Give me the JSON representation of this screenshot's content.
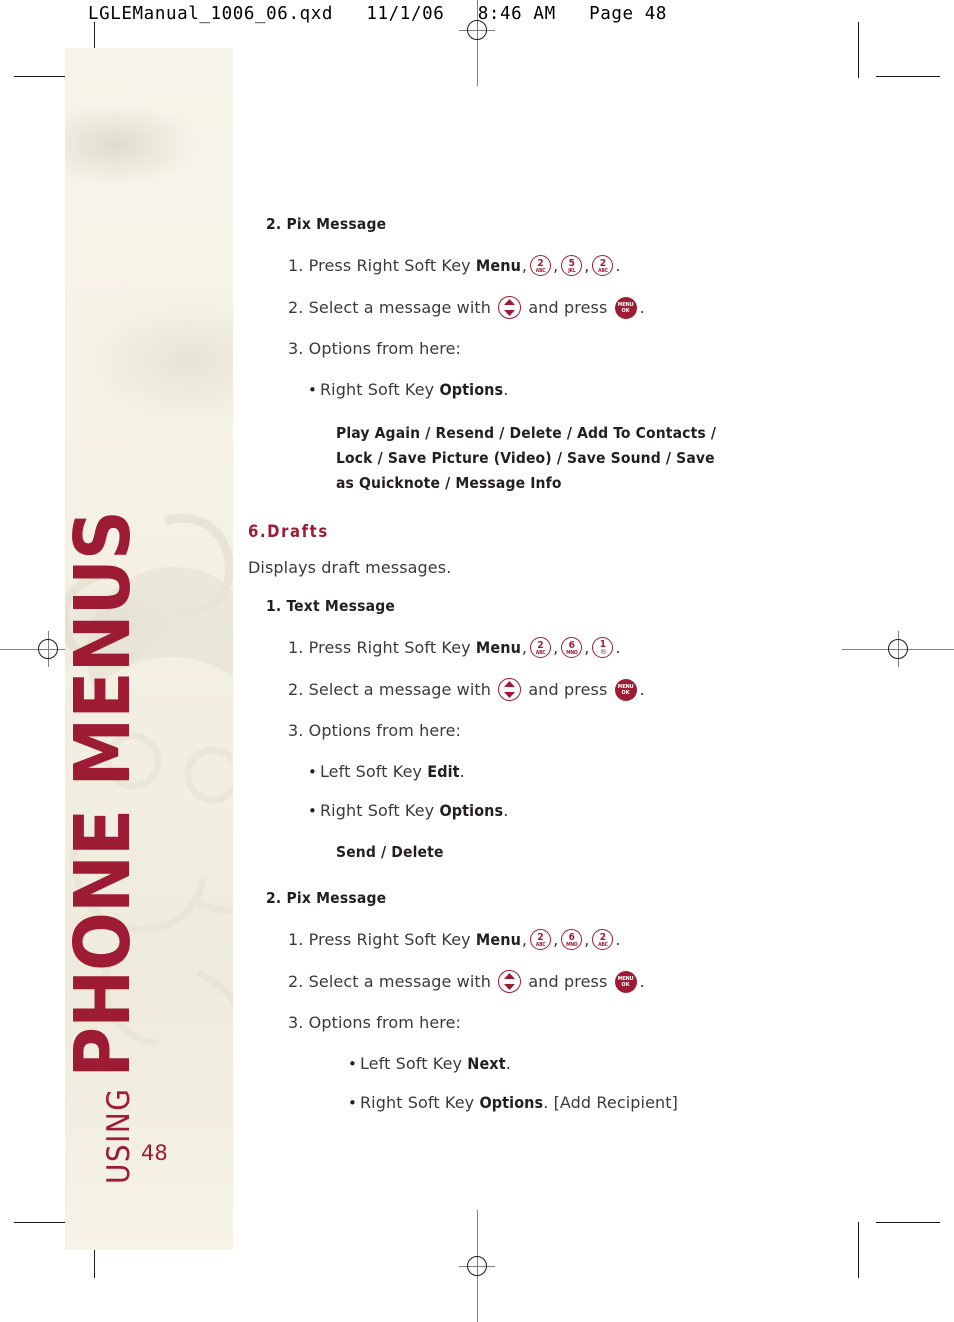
{
  "prepress": {
    "header": "LGLEManual_1006_06.qxd   11/1/06   8:46 AM   Page 48"
  },
  "sidebar": {
    "chapter_kicker": "USING",
    "chapter_title": "PHONE MENUS",
    "page_number": "48",
    "accent_color": "#9e1b34",
    "background_color": "#f6f3e7"
  },
  "content": {
    "blocks": [
      {
        "id": "pix-message-top",
        "heading": "2. Pix Message",
        "steps": [
          {
            "number": "1.",
            "text_before": "Press Right Soft Key",
            "bold_label": "Menu",
            "keys": [
              {
                "num": "2",
                "sub": "ABC"
              },
              {
                "num": "5",
                "sub": "JKL"
              },
              {
                "num": "2",
                "sub": "ABC"
              }
            ],
            "trailing": "."
          },
          {
            "number": "2.",
            "text_before": "Select a message with",
            "nav_key": "up-down-nav-key",
            "text_middle": "and press",
            "ok_key": {
              "line1": "MENU",
              "line2": "OK"
            },
            "trailing": "."
          },
          {
            "number": "3.",
            "text_before": "Options from here:"
          }
        ],
        "bullets": [
          {
            "text_before": "Right Soft Key",
            "bold_label": "Options",
            "trailing": "."
          }
        ],
        "options_lines": [
          "Play Again / Resend / Delete / Add To Contacts /",
          "Lock / Save Picture (Video) / Save Sound / Save",
          "as Quicknote / Message Info"
        ]
      },
      {
        "id": "drafts",
        "section_heading": "6.Drafts",
        "description": "Displays draft messages."
      },
      {
        "id": "text-message",
        "heading": "1. Text Message",
        "steps": [
          {
            "number": "1.",
            "text_before": "Press Right Soft Key",
            "bold_label": "Menu",
            "keys": [
              {
                "num": "2",
                "sub": "ABC"
              },
              {
                "num": "6",
                "sub": "MNO"
              },
              {
                "num": "1",
                "sub": "envelope-icon"
              }
            ],
            "trailing": "."
          },
          {
            "number": "2.",
            "text_before": "Select a message with",
            "nav_key": "up-down-nav-key",
            "text_middle": "and press",
            "ok_key": {
              "line1": "MENU",
              "line2": "OK"
            },
            "trailing": "."
          },
          {
            "number": "3.",
            "text_before": "Options from here:"
          }
        ],
        "bullets": [
          {
            "text_before": "Left Soft Key",
            "bold_label": "Edit",
            "trailing": "."
          },
          {
            "text_before": "Right Soft Key",
            "bold_label": "Options",
            "trailing": "."
          }
        ],
        "options_lines": [
          "Send / Delete"
        ]
      },
      {
        "id": "pix-message-bottom",
        "heading": "2. Pix Message",
        "steps": [
          {
            "number": "1.",
            "text_before": "Press Right Soft Key",
            "bold_label": "Menu",
            "keys": [
              {
                "num": "2",
                "sub": "ABC"
              },
              {
                "num": "6",
                "sub": "MNO"
              },
              {
                "num": "2",
                "sub": "ABC"
              }
            ],
            "trailing": "."
          },
          {
            "number": "2.",
            "text_before": "Select a message with",
            "nav_key": "up-down-nav-key",
            "text_middle": "and press",
            "ok_key": {
              "line1": "MENU",
              "line2": "OK"
            },
            "trailing": "."
          },
          {
            "number": "3.",
            "text_before": "Options from here:"
          }
        ],
        "bullets": [
          {
            "text_before": "Left Soft Key",
            "bold_label": "Next",
            "trailing": "."
          },
          {
            "text_before": "Right Soft Key",
            "bold_label": "Options",
            "trailing": ". [Add Recipient]"
          }
        ]
      }
    ]
  }
}
